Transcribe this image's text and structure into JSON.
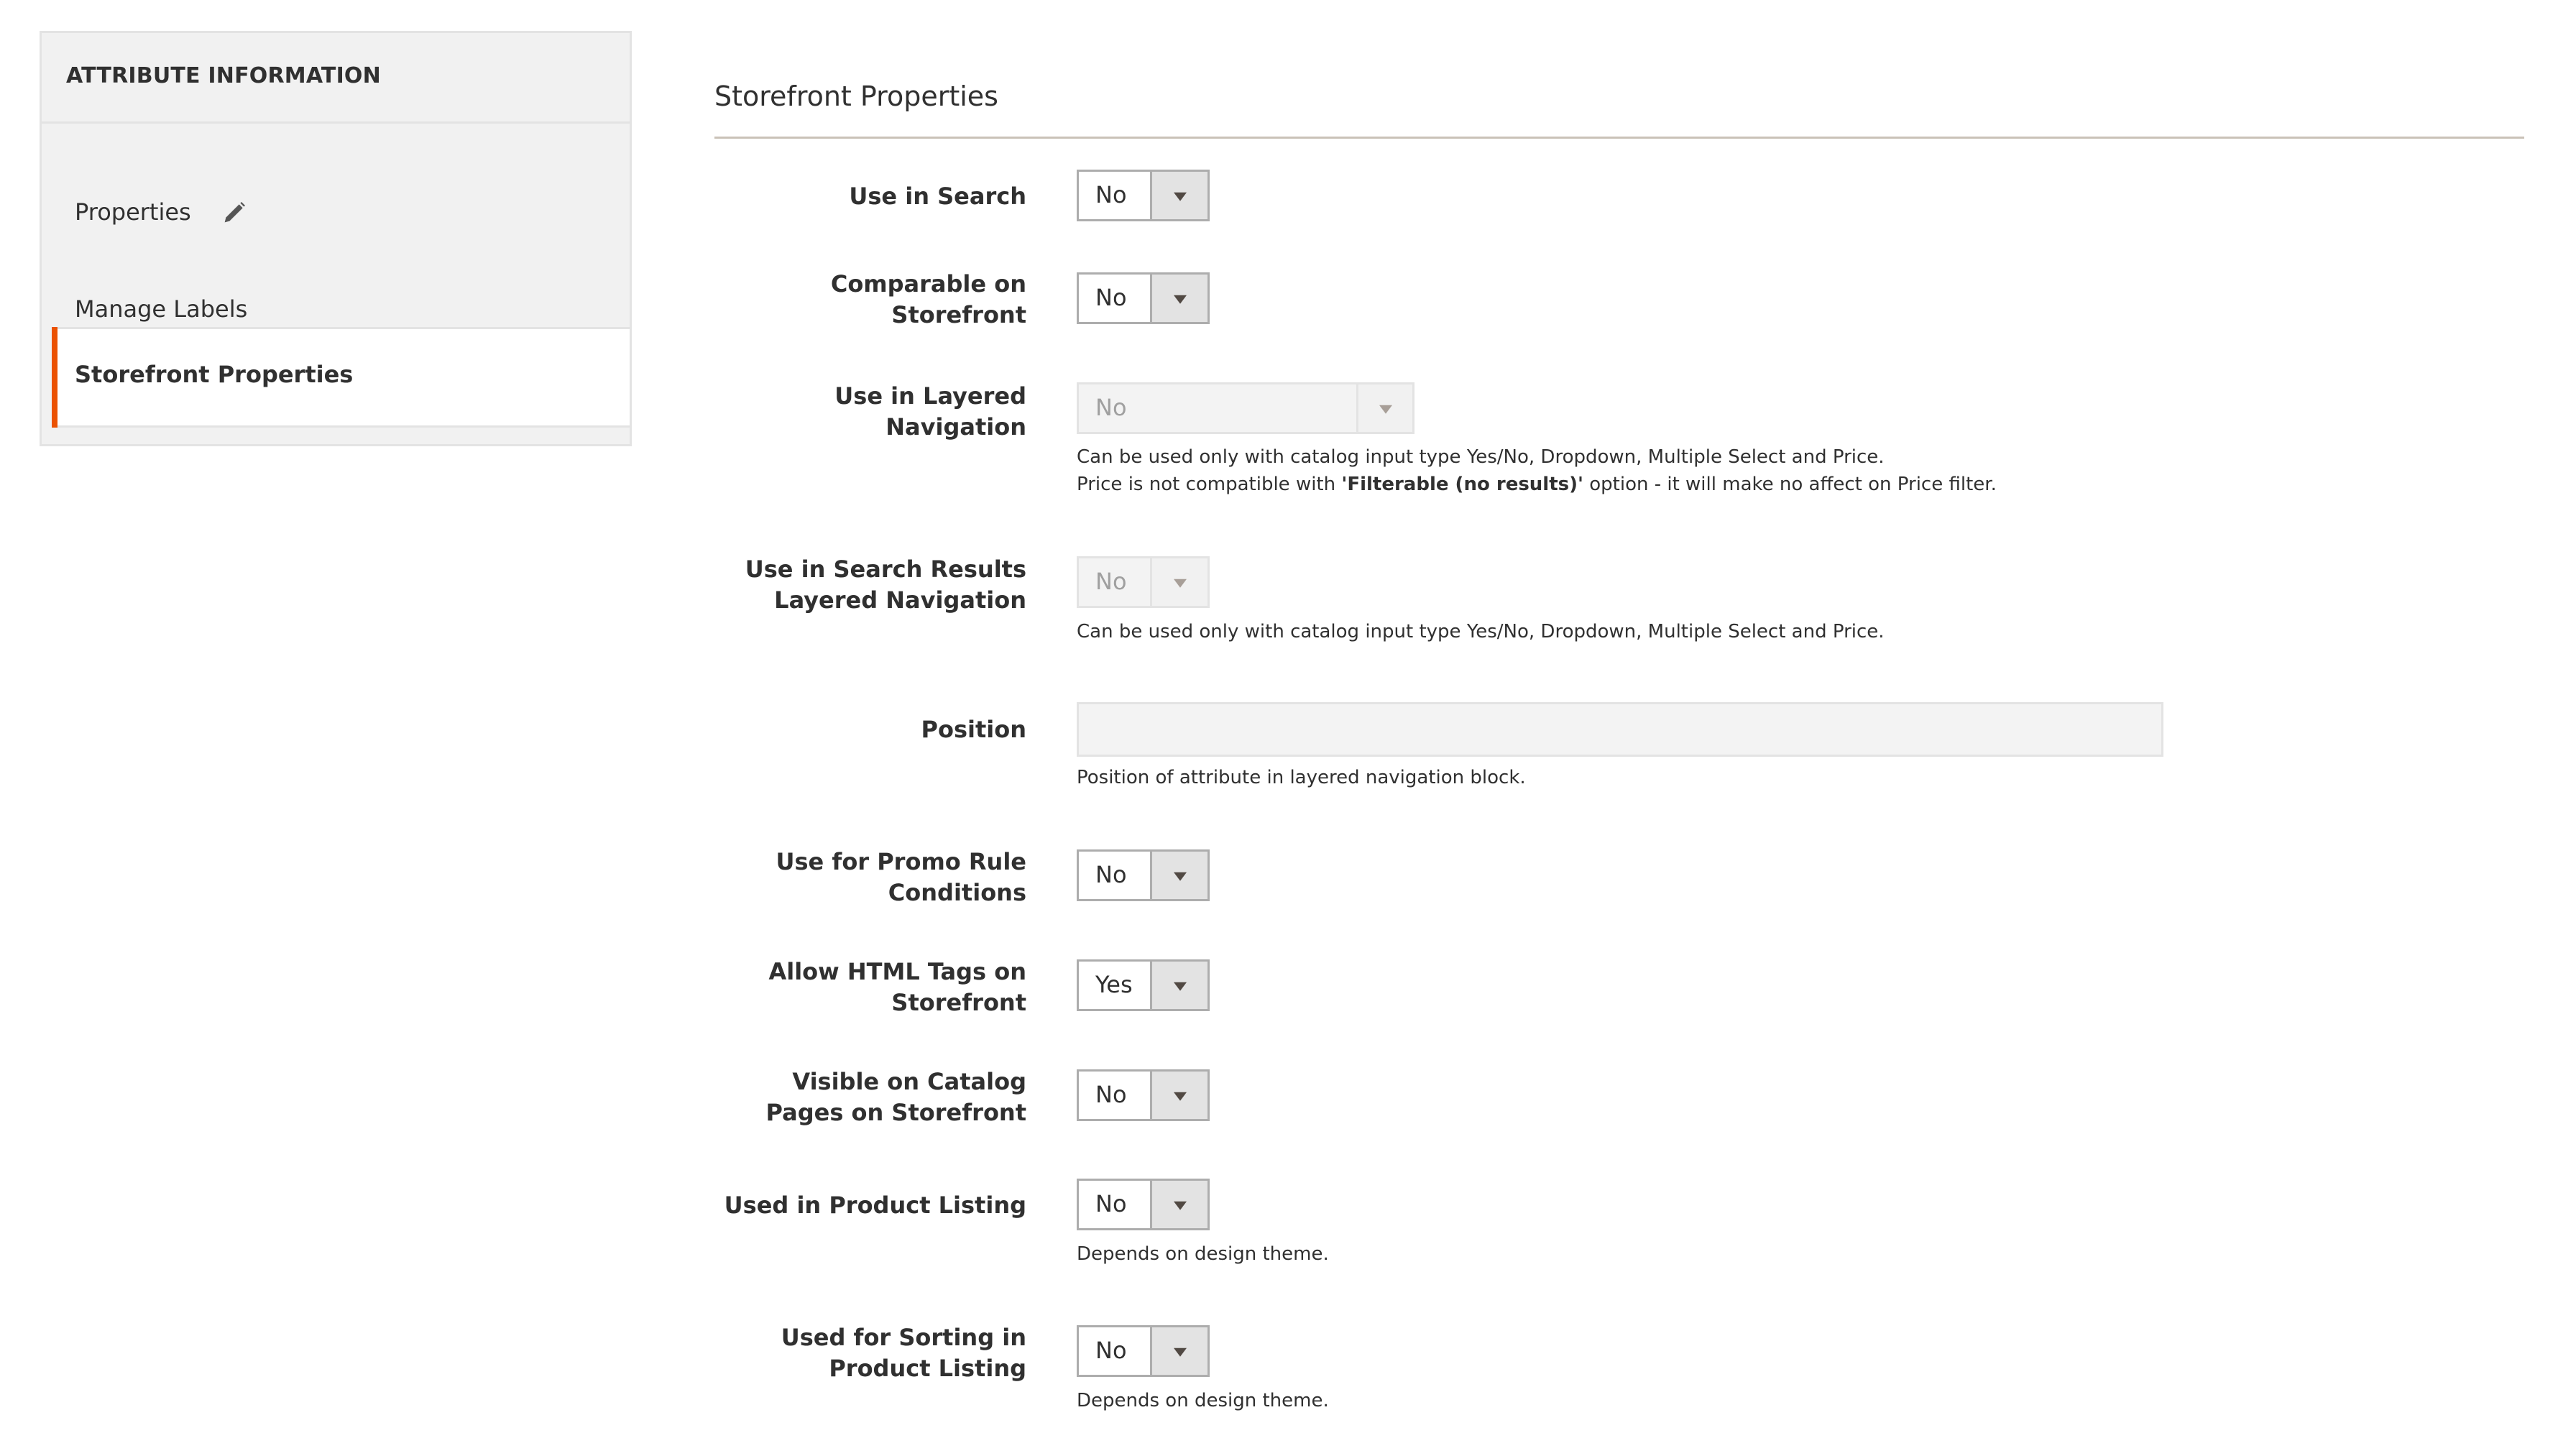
{
  "sidebar": {
    "header": "ATTRIBUTE INFORMATION",
    "items": [
      {
        "label": "Properties",
        "icon": "pencil-icon",
        "active": false
      },
      {
        "label": "Manage Labels",
        "active": false
      },
      {
        "label": "Storefront Properties",
        "active": true
      }
    ]
  },
  "main": {
    "title": "Storefront Properties",
    "fields": [
      {
        "label": "Use in Search",
        "value": "No",
        "type": "select"
      },
      {
        "label_lines": [
          "Comparable on",
          "Storefront"
        ],
        "value": "No",
        "type": "select"
      },
      {
        "label_lines": [
          "Use in Layered",
          "Navigation"
        ],
        "value": "No",
        "type": "select",
        "disabled": true,
        "note_lines": [
          "Can be used only with catalog input type Yes/No, Dropdown, Multiple Select and Price."
        ],
        "note2_prefix": "Price is not compatible with ",
        "note2_bold": "'Filterable (no results)'",
        "note2_suffix": " option - it will make no affect on Price filter."
      },
      {
        "label_lines": [
          "Use in Search Results",
          "Layered Navigation"
        ],
        "value": "No",
        "type": "select",
        "disabled": true,
        "note": "Can be used only with catalog input type Yes/No, Dropdown, Multiple Select and Price."
      },
      {
        "label": "Position",
        "value": "",
        "type": "text",
        "disabled": true,
        "note": "Position of attribute in layered navigation block."
      },
      {
        "label_lines": [
          "Use for Promo Rule",
          "Conditions"
        ],
        "value": "No",
        "type": "select"
      },
      {
        "label_lines": [
          "Allow HTML Tags on",
          "Storefront"
        ],
        "value": "Yes",
        "type": "select"
      },
      {
        "label_lines": [
          "Visible on Catalog",
          "Pages on Storefront"
        ],
        "value": "No",
        "type": "select"
      },
      {
        "label": "Used in Product Listing",
        "value": "No",
        "type": "select",
        "note": "Depends on design theme."
      },
      {
        "label_lines": [
          "Used for Sorting in",
          "Product Listing"
        ],
        "value": "No",
        "type": "select",
        "note": "Depends on design theme."
      }
    ]
  },
  "colors": {
    "accent": "#eb5202",
    "sidebar_bg": "#f1f1f1",
    "border": "#adadad",
    "text": "#303030"
  }
}
